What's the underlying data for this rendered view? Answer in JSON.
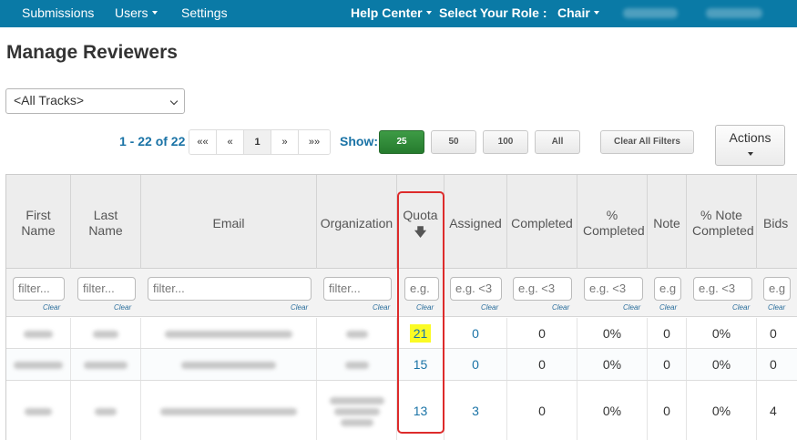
{
  "nav": {
    "submissions": "Submissions",
    "users": "Users",
    "settings": "Settings",
    "help_center": "Help Center",
    "select_role_label": "Select Your Role :",
    "role": "Chair"
  },
  "page_title": "Manage Reviewers",
  "tracks_select": {
    "value": "<All Tracks>"
  },
  "pagination": {
    "range": "1 - 22 of 22",
    "first": "««",
    "prev": "«",
    "current": "1",
    "next": "»",
    "last": "»»"
  },
  "show": {
    "label": "Show:",
    "options": [
      "25",
      "50",
      "100",
      "All"
    ],
    "selected": "25"
  },
  "clear_all_filters": "Clear All Filters",
  "actions_label": "Actions",
  "table": {
    "columns": {
      "first_name": "First Name",
      "last_name": "Last Name",
      "email": "Email",
      "organization": "Organization",
      "quota": "Quota",
      "assigned": "Assigned",
      "completed": "Completed",
      "pct_completed": "% Completed",
      "note": "Note",
      "pct_note_completed": "% Note Completed",
      "bids": "Bids"
    },
    "sort_icon": "arrow-down-icon",
    "filters": {
      "text_placeholder": "filter...",
      "quota": "e.g.",
      "assigned": "e.g. <3",
      "completed": "e.g. <3",
      "pct_completed": "e.g. <3",
      "note": "e.g",
      "pct_note_completed": "e.g. <3",
      "bids": "e.g",
      "clear": "Clear"
    },
    "rows": [
      {
        "quota": "21",
        "assigned": "0",
        "completed": "0",
        "pct_completed": "0%",
        "note": "0",
        "pct_note_completed": "0%",
        "bids": "0",
        "highlight_quota": true
      },
      {
        "quota": "15",
        "assigned": "0",
        "completed": "0",
        "pct_completed": "0%",
        "note": "0",
        "pct_note_completed": "0%",
        "bids": "0"
      },
      {
        "quota": "13",
        "assigned": "3",
        "completed": "0",
        "pct_completed": "0%",
        "note": "0",
        "pct_note_completed": "0%",
        "bids": "4"
      }
    ]
  },
  "colors": {
    "navbar": "#0a7aa6",
    "accent_link": "#1a73a6",
    "active_page_size": "#2f8a37",
    "quota_highlight": "#fbfb25",
    "annotation_box": "#dd2b2b"
  }
}
